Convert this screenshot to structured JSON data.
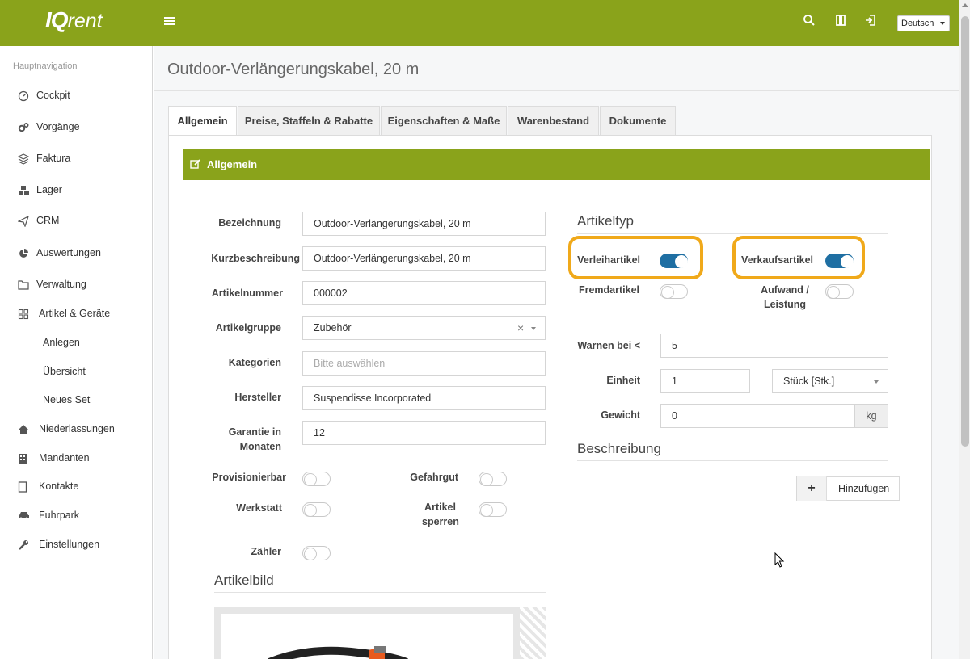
{
  "topbar": {
    "logo_main": "IQ",
    "logo_sub": "rent",
    "menu_icon": "hamburger-icon",
    "language": "Deutsch",
    "colors": {
      "brand": "#8aa31b",
      "toggle_on": "#1f6fa3",
      "highlight": "#f0a91a"
    }
  },
  "sidebar": {
    "heading": "Hauptnavigation",
    "items": [
      {
        "label": "Cockpit",
        "icon": "gauge-icon"
      },
      {
        "label": "Vorgänge",
        "icon": "gears-icon"
      },
      {
        "label": "Faktura",
        "icon": "layers-icon"
      },
      {
        "label": "Lager",
        "icon": "cubes-icon"
      },
      {
        "label": "CRM",
        "icon": "paper-plane-icon"
      },
      {
        "label": "Auswertungen",
        "icon": "pie-chart-icon"
      },
      {
        "label": "Verwaltung",
        "icon": "folder-icon"
      },
      {
        "label": "Artikel & Geräte",
        "icon": "grid-icon"
      },
      {
        "label": "Anlegen",
        "icon": ""
      },
      {
        "label": "Übersicht",
        "icon": ""
      },
      {
        "label": "Neues Set",
        "icon": ""
      },
      {
        "label": "Niederlassungen",
        "icon": "home-icon"
      },
      {
        "label": "Mandanten",
        "icon": "building-icon"
      },
      {
        "label": "Kontakte",
        "icon": "contact-card-icon"
      },
      {
        "label": "Fuhrpark",
        "icon": "car-icon"
      },
      {
        "label": "Einstellungen",
        "icon": "wrench-icon"
      }
    ]
  },
  "page": {
    "title": "Outdoor-Verlängerungskabel, 20 m",
    "tabs": [
      "Allgemein",
      "Preise, Staffeln & Rabatte",
      "Eigenschaften & Maße",
      "Warenbestand",
      "Dokumente"
    ],
    "active_tab": "Allgemein",
    "panel_title": "Allgemein"
  },
  "form": {
    "bezeichnung": {
      "label": "Bezeichnung",
      "value": "Outdoor-Verlängerungskabel, 20 m"
    },
    "kurzbeschreibung": {
      "label": "Kurzbeschreibung",
      "value": "Outdoor-Verlängerungskabel, 20 m"
    },
    "artikelnummer": {
      "label": "Artikelnummer",
      "value": "000002"
    },
    "artikelgruppe": {
      "label": "Artikelgruppe",
      "value": "Zubehör",
      "clear": "×"
    },
    "kategorien": {
      "label": "Kategorien",
      "placeholder": "Bitte auswählen"
    },
    "hersteller": {
      "label": "Hersteller",
      "value": "Suspendisse Incorporated"
    },
    "garantie": {
      "label_line1": "Garantie in",
      "label_line2": "Monaten",
      "value": "12"
    },
    "toggles": {
      "provisionierbar": {
        "label": "Provisionierbar",
        "on": false
      },
      "gefahrgut": {
        "label": "Gefahrgut",
        "on": false
      },
      "werkstatt": {
        "label": "Werkstatt",
        "on": false
      },
      "artikel_sperren": {
        "label_line1": "Artikel",
        "label_line2": "sperren",
        "on": false
      },
      "zaehler": {
        "label": "Zähler",
        "on": false
      }
    },
    "artikelbild_heading": "Artikelbild"
  },
  "artikeltyp": {
    "heading": "Artikeltyp",
    "verleihartikel": {
      "label": "Verleihartikel",
      "on": true
    },
    "verkaufsartikel": {
      "label": "Verkaufsartikel",
      "on": true
    },
    "fremdartikel": {
      "label": "Fremdartikel",
      "on": false
    },
    "aufwand": {
      "label_line1": "Aufwand /",
      "label_line2": "Leistung",
      "on": false
    },
    "warnen": {
      "label": "Warnen bei <",
      "value": "5"
    },
    "einheit": {
      "label": "Einheit",
      "value": "1",
      "unit": "Stück [Stk.]"
    },
    "gewicht": {
      "label": "Gewicht",
      "value": "0",
      "unit": "kg"
    }
  },
  "beschreibung": {
    "heading": "Beschreibung",
    "add_icon": "+",
    "add_label": "Hinzufügen"
  }
}
